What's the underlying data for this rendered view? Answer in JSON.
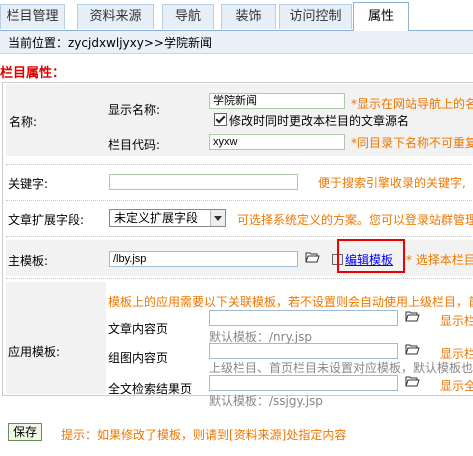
{
  "tabs": [
    {
      "label": "栏目管理"
    },
    {
      "label": "资料来源"
    },
    {
      "label": "导航"
    },
    {
      "label": "装饰"
    },
    {
      "label": "访问控制"
    },
    {
      "label": "属性"
    }
  ],
  "breadcrumb": "当前位置：zycjdxwljyxy>>学院新闻",
  "section_title": "栏目属性：",
  "name_row": {
    "label": "名称:",
    "display_name_label": "显示名称:",
    "display_name_value": "学院新闻",
    "display_name_hint": "*显示在网站导航上的名称",
    "sync_checkbox_label": "修改时同时更改本栏目的文章源名",
    "code_label": "栏目代码:",
    "code_value": "xyxw",
    "code_hint": "*同目录下名称不可重复"
  },
  "keywords": {
    "label": "关键字:",
    "value": "",
    "hint": "便于搜索引擎收录的关键字,"
  },
  "ext_fields": {
    "label": "文章扩展字段:",
    "selected": "未定义扩展字段",
    "hint": "可选择系统定义的方案。您可以登录站群管理"
  },
  "main_template": {
    "label": "主模板:",
    "value": "/lby.jsp",
    "edit_link": "编辑模板",
    "hint": "* 选择本栏目"
  },
  "app_templates": {
    "label": "应用模板:",
    "note": "模板上的应用需要以下关联模板，若不设置则会自动使用上级栏目，首",
    "rows": [
      {
        "label": "文章内容页",
        "value": "",
        "default": "默认模板：/nry.jsp",
        "hint": "显示栏"
      },
      {
        "label": "组图内容页",
        "value": "",
        "default": "上级栏目、首页栏目未设置对应模板，默认模板也",
        "hint": "显示栏"
      },
      {
        "label": "全文检索结果页",
        "value": "",
        "default": "默认模板：/ssjgy.jsp",
        "hint": "显示全"
      }
    ]
  },
  "save_button": "保存",
  "footer_tip": "提示：如果修改了模板，则请到[资料来源]处指定内容",
  "colors": {
    "accent_red": "#e00000",
    "hint_orange": "#ee7700",
    "link_blue": "#0000ff",
    "tab_border": "#8cb2d8"
  }
}
